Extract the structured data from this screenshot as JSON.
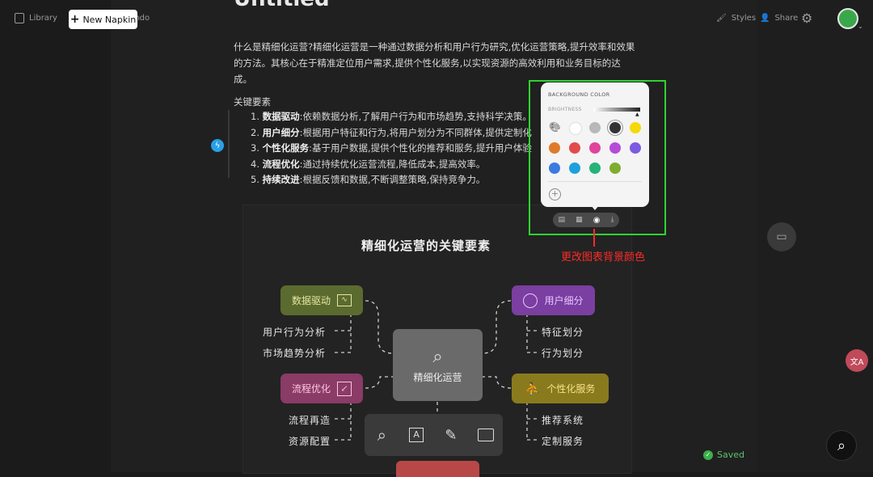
{
  "topbar": {
    "library": "Library",
    "new_napkin": "New Napkin",
    "undo": "Undo",
    "styles": "Styles",
    "share": "Share"
  },
  "doc": {
    "title": "Untitled",
    "paragraph": "什么是精细化运营?精细化运营是一种通过数据分析和用户行为研究,优化运营策略,提升效率和效果的方法。其核心在于精准定位用户需求,提供个性化服务,以实现资源的高效利用和业务目标的达成。",
    "key_heading": "关键要素",
    "items": [
      {
        "num": "1.",
        "bold": "数据驱动",
        "text": ":依赖数据分析,了解用户行为和市场趋势,支持科学决策。"
      },
      {
        "num": "2.",
        "bold": "用户细分",
        "text": ":根据用户特征和行为,将用户划分为不同群体,提供定制化"
      },
      {
        "num": "3.",
        "bold": "个性化服务",
        "text": ":基于用户数据,提供个性化的推荐和服务,提升用户体验"
      },
      {
        "num": "4.",
        "bold": "流程优化",
        "text": ":通过持续优化运营流程,降低成本,提高效率。"
      },
      {
        "num": "5.",
        "bold": "持续改进",
        "text": ":根据反馈和数据,不断调整策略,保持竞争力。"
      }
    ]
  },
  "diagram": {
    "title": "精细化运营的关键要素",
    "center": "精细化运营",
    "nodes": {
      "data": "数据驱动",
      "user": "用户细分",
      "process": "流程优化",
      "service": "个性化服务"
    },
    "subs": {
      "data1": "用户行为分析",
      "data2": "市场趋势分析",
      "user1": "特征划分",
      "user2": "行为划分",
      "proc1": "流程再造",
      "proc2": "资源配置",
      "serv1": "推荐系统",
      "serv2": "定制服务"
    },
    "colors": {
      "data": "#5b6b2f",
      "user": "#7a3fa0",
      "process": "#8a3b66",
      "service": "#8a7a1e",
      "center": "#6a6a6a"
    }
  },
  "popup": {
    "header": "BACKGROUND COLOR",
    "brightness": "BRIGHTNESS",
    "swatches_row1": [
      "#ffffff",
      "#b8b8b8",
      "#333333",
      "#f5d90a"
    ],
    "swatches_row2": [
      "#e07a2a",
      "#e24b4b",
      "#e0449a",
      "#b54bd9",
      "#7d5be0"
    ],
    "swatches_row3": [
      "#3b7be0",
      "#1ea0dc",
      "#25b37a",
      "#7fae2e"
    ]
  },
  "annotation": "更改图表背景颜色",
  "status": {
    "saved": "Saved"
  }
}
